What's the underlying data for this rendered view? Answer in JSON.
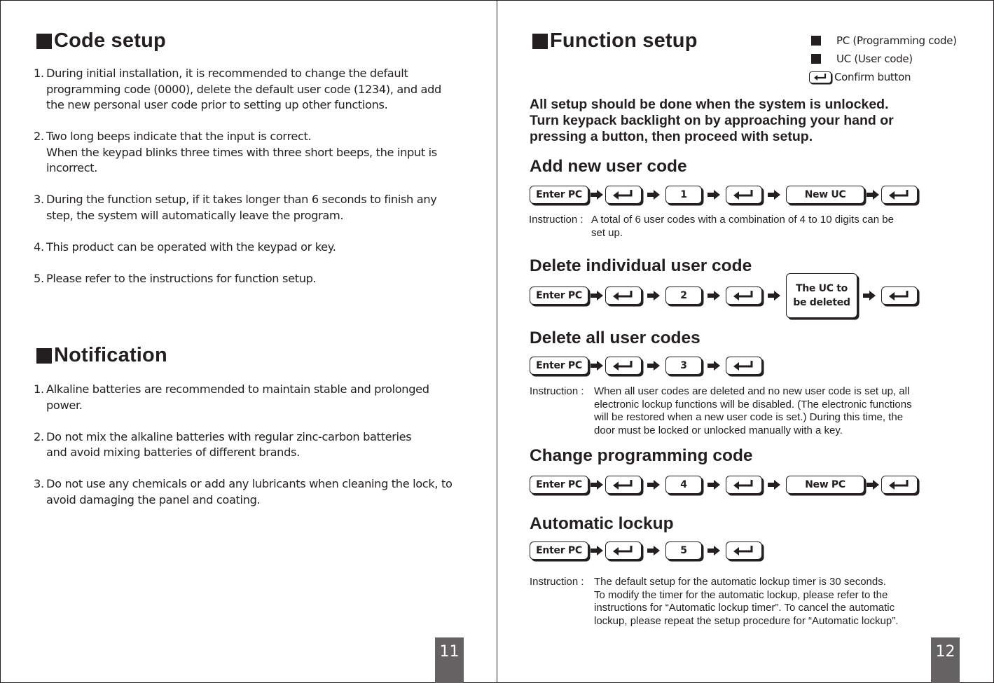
{
  "left_page": {
    "code_setup": {
      "title": "Code setup",
      "items": [
        {
          "num": "1.",
          "lines": [
            "During initial installation, it is recommended to change the default",
            "programming code (0000), delete the default user code (1234), and add",
            "the new personal user code prior to setting up other functions."
          ]
        },
        {
          "num": "2.",
          "lines": [
            "Two long beeps indicate that the input is correct.",
            "When the keypad blinks three times with three short beeps, the input is",
            "incorrect."
          ]
        },
        {
          "num": "3.",
          "lines": [
            "During the function setup, if it takes longer than 6 seconds to finish any",
            "step, the system will automatically leave the program."
          ]
        },
        {
          "num": "4.",
          "lines": [
            "This product can be operated with the keypad or key."
          ]
        },
        {
          "num": "5.",
          "lines": [
            "Please refer to the instructions for function setup."
          ]
        }
      ]
    },
    "notification": {
      "title": "Notification",
      "items": [
        {
          "num": "1.",
          "lines": [
            "Alkaline batteries are recommended to maintain stable and prolonged",
            "power."
          ]
        },
        {
          "num": "2.",
          "lines": [
            "Do not mix the alkaline batteries with regular zinc-carbon batteries",
            "and avoid mixing batteries of different brands."
          ]
        },
        {
          "num": "3.",
          "lines": [
            "Do not use any chemicals or add any lubricants when cleaning the lock, to",
            "avoid damaging the panel and coating."
          ]
        }
      ]
    },
    "page_number": "11"
  },
  "right_page": {
    "title": "Function setup",
    "legend": {
      "pc": "PC (Programming code)",
      "uc": "UC (User code)",
      "confirm": "Confirm button",
      "confirm_icon": "return-arrow-icon"
    },
    "intro": [
      "All setup should be done when the system is unlocked.",
      "Turn keypack backlight on by approaching your hand or",
      "pressing a button, then proceed with setup."
    ],
    "enter_pc": "Enter PC",
    "instruction_label": "Instruction :",
    "sections": {
      "add": {
        "title": "Add new user code",
        "digit": "1",
        "last": "New UC",
        "instruction": [
          "A total of 6 user codes with a combination of 4 to 10 digits can be",
          "set up."
        ]
      },
      "delete_one": {
        "title": "Delete individual user code",
        "digit": "2",
        "last_lines": [
          "The UC to",
          "be deleted"
        ]
      },
      "delete_all": {
        "title": "Delete all user codes",
        "digit": "3",
        "instruction": [
          "When all user codes are deleted and no new user code is set up, all",
          "electronic lockup functions will be disabled. (The electronic functions",
          "will be restored when a new user code is set.) During this time, the",
          "door must be locked or unlocked manually with a key."
        ]
      },
      "change_pc": {
        "title": "Change programming code",
        "digit": "4",
        "last": "New PC"
      },
      "auto_lock": {
        "title": "Automatic lockup",
        "digit": "5",
        "instruction": [
          "The default setup for the automatic lockup timer is 30 seconds.",
          "To modify the timer for the automatic lockup, please refer to the",
          "instructions for “Automatic lockup timer”. To cancel the automatic",
          "lockup, please repeat the setup procedure for “Automatic lockup”."
        ]
      }
    },
    "page_number": "12"
  }
}
